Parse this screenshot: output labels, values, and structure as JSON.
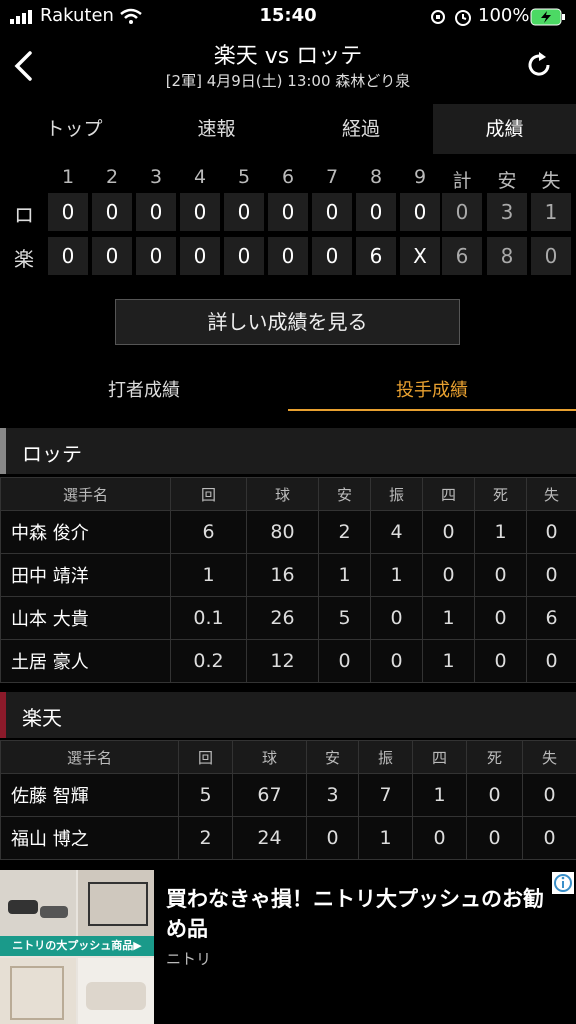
{
  "status": {
    "carrier": "Rakuten",
    "time": "15:40",
    "battery": "100%"
  },
  "header": {
    "title": "楽天 vs ロッテ",
    "subtitle": "[2軍] 4月9日(土) 13:00 森林どり泉"
  },
  "tabs": [
    "トップ",
    "速報",
    "経過",
    "成績"
  ],
  "scoreboard": {
    "headers": [
      "1",
      "2",
      "3",
      "4",
      "5",
      "6",
      "7",
      "8",
      "9",
      "計",
      "安",
      "失"
    ],
    "rows": [
      {
        "team": "ロ",
        "cells": [
          "0",
          "0",
          "0",
          "0",
          "0",
          "0",
          "0",
          "0",
          "0",
          "0",
          "3",
          "1"
        ]
      },
      {
        "team": "楽",
        "cells": [
          "0",
          "0",
          "0",
          "0",
          "0",
          "0",
          "0",
          "6",
          "X",
          "6",
          "8",
          "0"
        ]
      }
    ]
  },
  "detail_button": "詳しい成績を見る",
  "subtabs": [
    "打者成績",
    "投手成績"
  ],
  "colors": {
    "accent": "#e8a030",
    "lotte_bar": "#888888",
    "rakuten_bar": "#8b1a2a"
  },
  "teams": [
    {
      "name": "ロッテ",
      "headers": [
        "選手名",
        "回",
        "球",
        "安",
        "振",
        "四",
        "死",
        "失"
      ],
      "rows": [
        [
          "中森 俊介",
          "6",
          "80",
          "2",
          "4",
          "0",
          "1",
          "0"
        ],
        [
          "田中 靖洋",
          "1",
          "16",
          "1",
          "1",
          "0",
          "0",
          "0"
        ],
        [
          "山本 大貴",
          "0.1",
          "26",
          "5",
          "0",
          "1",
          "0",
          "6"
        ],
        [
          "土居 豪人",
          "0.2",
          "12",
          "0",
          "0",
          "1",
          "0",
          "0"
        ]
      ]
    },
    {
      "name": "楽天",
      "headers": [
        "選手名",
        "回",
        "球",
        "安",
        "振",
        "四",
        "死",
        "失"
      ],
      "rows": [
        [
          "佐藤 智輝",
          "5",
          "67",
          "3",
          "7",
          "1",
          "0",
          "0"
        ],
        [
          "福山 博之",
          "2",
          "24",
          "0",
          "1",
          "0",
          "0",
          "0"
        ]
      ]
    }
  ],
  "ad": {
    "title": "買わなきゃ損！ニトリ大プッシュのお勧め品",
    "advertiser": "ニトリ",
    "image_caption": "ニトリの大プッシュ商品▶"
  }
}
